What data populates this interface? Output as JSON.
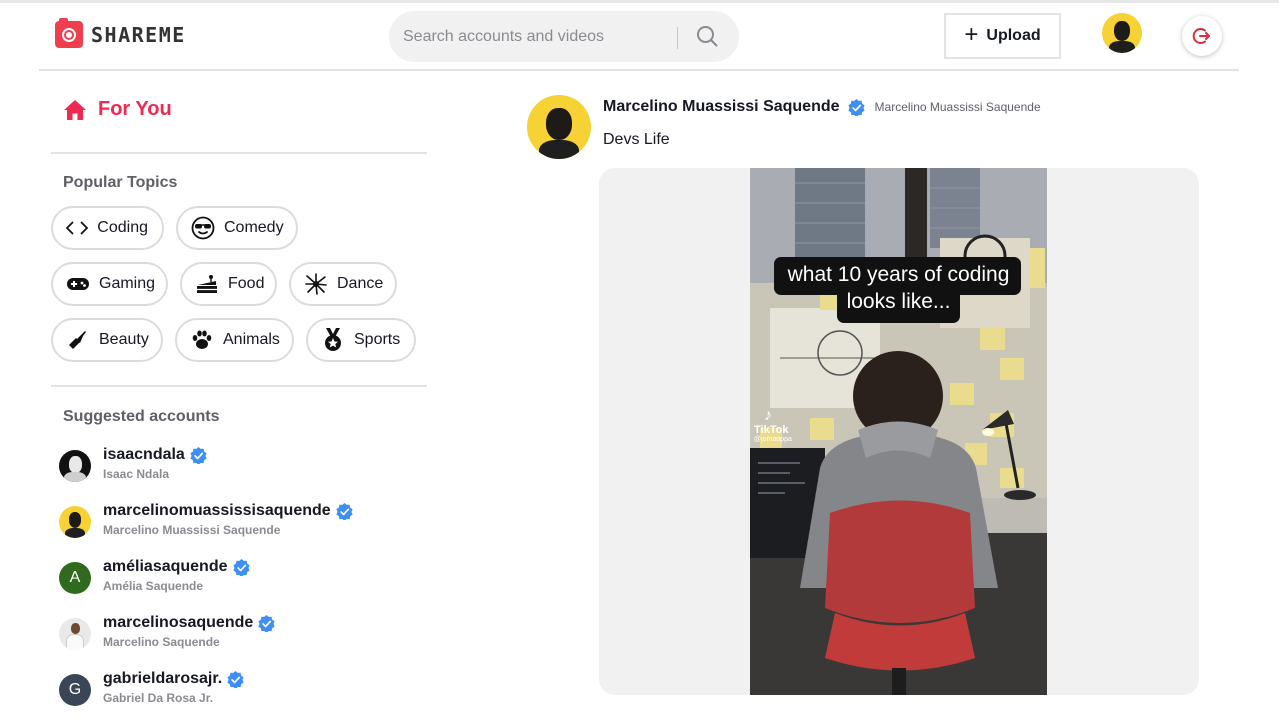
{
  "app": {
    "name": "SHAREME"
  },
  "header": {
    "search_placeholder": "Search accounts and videos",
    "upload_label": "Upload"
  },
  "sidebar": {
    "for_you_label": "For You",
    "popular_topics_title": "Popular Topics",
    "topics": [
      {
        "label": "Coding",
        "icon": "code-icon"
      },
      {
        "label": "Comedy",
        "icon": "sunglasses-face-icon"
      },
      {
        "label": "Gaming",
        "icon": "gamepad-icon"
      },
      {
        "label": "Food",
        "icon": "cake-icon"
      },
      {
        "label": "Dance",
        "icon": "dance-icon"
      },
      {
        "label": "Beauty",
        "icon": "lipstick-icon"
      },
      {
        "label": "Animals",
        "icon": "paw-icon"
      },
      {
        "label": "Sports",
        "icon": "medal-icon"
      }
    ],
    "suggested_title": "Suggested accounts",
    "accounts": [
      {
        "handle": "isaacndala",
        "name": "Isaac Ndala"
      },
      {
        "handle": "marcelinomuassissisaquende",
        "name": "Marcelino Muassissi Saquende"
      },
      {
        "handle": "améliasaquende",
        "name": "Amélia Saquende",
        "initial": "A",
        "color": "#2f6a1f"
      },
      {
        "handle": "marcelinosaquende",
        "name": "Marcelino Saquende"
      },
      {
        "handle": "gabrieldarosajr.",
        "name": "Gabriel Da Rosa Jr.",
        "initial": "G",
        "color": "#3a4656"
      }
    ]
  },
  "post": {
    "username": "Marcelino Muassissi Saquende",
    "fullname": "Marcelino Muassissi Saquende",
    "caption": "Devs Life",
    "video_overlay_line1": "what 10 years of coding",
    "video_overlay_line2": "looks like...",
    "watermark_brand": "TikTok",
    "watermark_handle": "@jomaoppa"
  },
  "colors": {
    "accent": "#ef2950",
    "verified": "#3d8ef5",
    "avatar_yellow": "#f7d235"
  }
}
